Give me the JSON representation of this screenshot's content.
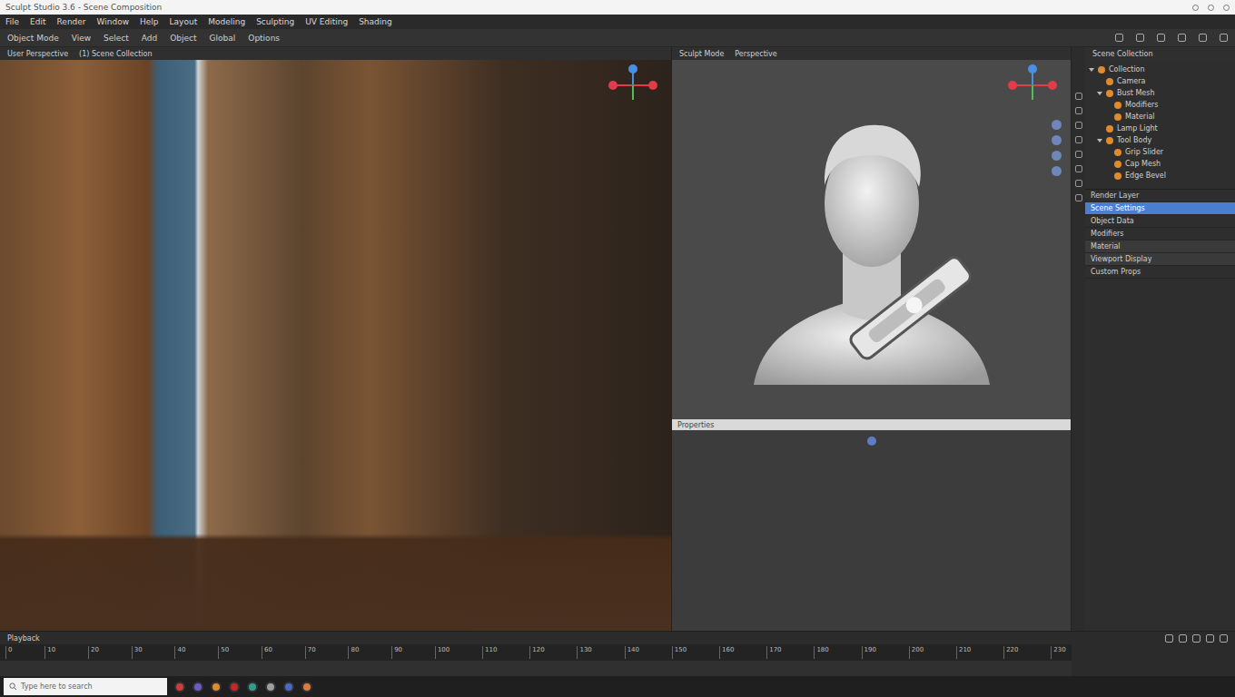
{
  "window": {
    "title": "Sculpt Studio 3.6 - Scene Composition",
    "menu": [
      "File",
      "Edit",
      "Render",
      "Window",
      "Help",
      "Layout",
      "Modeling",
      "Sculpting",
      "UV Editing",
      "Shading"
    ]
  },
  "toolbar": {
    "items": [
      "Object Mode",
      "View",
      "Select",
      "Add",
      "Object",
      "Global",
      "Options"
    ]
  },
  "left_viewport": {
    "title": "User Perspective",
    "subtitle": "(1) Scene Collection"
  },
  "right_viewport": {
    "title": "Sculpt Mode",
    "subtitle": "Perspective"
  },
  "divider": {
    "label": "Properties"
  },
  "outliner": {
    "title": "Scene Collection",
    "tree": [
      {
        "label": "Collection",
        "expanded": true,
        "children": [
          {
            "label": "Camera",
            "expanded": false,
            "children": []
          },
          {
            "label": "Bust Mesh",
            "expanded": true,
            "children": [
              {
                "label": "Modifiers",
                "expanded": false,
                "children": []
              },
              {
                "label": "Material",
                "expanded": false,
                "children": []
              }
            ]
          },
          {
            "label": "Lamp Light",
            "expanded": false,
            "children": []
          },
          {
            "label": "Tool Body",
            "expanded": true,
            "children": [
              {
                "label": "Grip Slider",
                "expanded": false,
                "children": []
              },
              {
                "label": "Cap Mesh",
                "expanded": false,
                "children": []
              },
              {
                "label": "Edge Bevel",
                "expanded": false,
                "children": []
              }
            ]
          }
        ]
      }
    ]
  },
  "properties": [
    {
      "label": "Render Layer",
      "selected": false,
      "kind": "row"
    },
    {
      "label": "Scene Settings",
      "selected": true,
      "kind": "row"
    },
    {
      "label": "Object Data",
      "selected": false,
      "kind": "row"
    },
    {
      "label": "Modifiers",
      "selected": false,
      "kind": "row"
    },
    {
      "label": "Material",
      "selected": false,
      "kind": "section"
    },
    {
      "label": "Viewport Display",
      "selected": false,
      "kind": "section"
    },
    {
      "label": "Custom Props",
      "selected": false,
      "kind": "row"
    }
  ],
  "timeline": {
    "title": "Playback",
    "ticks": [
      "0",
      "10",
      "20",
      "30",
      "40",
      "50",
      "60",
      "70",
      "80",
      "90",
      "100",
      "110",
      "120",
      "130",
      "140",
      "150",
      "160",
      "170",
      "180",
      "190",
      "200",
      "210",
      "220",
      "230"
    ]
  },
  "taskbar": {
    "search_placeholder": "Type here to search",
    "apps": [
      {
        "color": "#d23b3b"
      },
      {
        "color": "#6a5acd"
      },
      {
        "color": "#e08a2e"
      },
      {
        "color": "#c62828"
      },
      {
        "color": "#2e9e8f"
      },
      {
        "color": "#9e9e9e"
      },
      {
        "color": "#4a67c9"
      },
      {
        "color": "#e07a3a"
      }
    ]
  }
}
